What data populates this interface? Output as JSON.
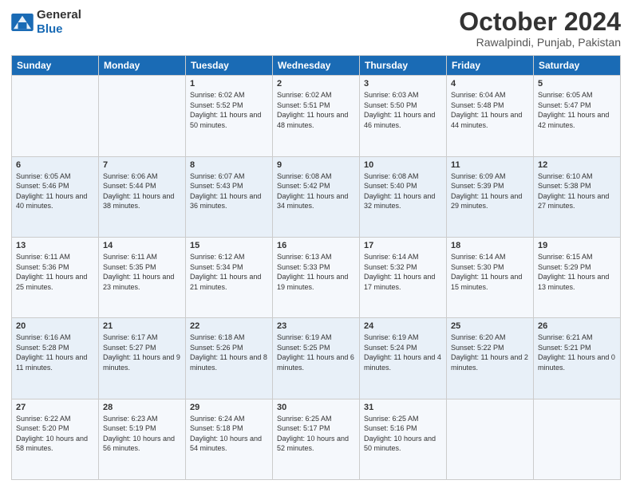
{
  "logo": {
    "general": "General",
    "blue": "Blue"
  },
  "header": {
    "month": "October 2024",
    "location": "Rawalpindi, Punjab, Pakistan"
  },
  "days": [
    "Sunday",
    "Monday",
    "Tuesday",
    "Wednesday",
    "Thursday",
    "Friday",
    "Saturday"
  ],
  "weeks": [
    [
      {
        "day": "",
        "content": ""
      },
      {
        "day": "",
        "content": ""
      },
      {
        "day": "1",
        "content": "Sunrise: 6:02 AM\nSunset: 5:52 PM\nDaylight: 11 hours and 50 minutes."
      },
      {
        "day": "2",
        "content": "Sunrise: 6:02 AM\nSunset: 5:51 PM\nDaylight: 11 hours and 48 minutes."
      },
      {
        "day": "3",
        "content": "Sunrise: 6:03 AM\nSunset: 5:50 PM\nDaylight: 11 hours and 46 minutes."
      },
      {
        "day": "4",
        "content": "Sunrise: 6:04 AM\nSunset: 5:48 PM\nDaylight: 11 hours and 44 minutes."
      },
      {
        "day": "5",
        "content": "Sunrise: 6:05 AM\nSunset: 5:47 PM\nDaylight: 11 hours and 42 minutes."
      }
    ],
    [
      {
        "day": "6",
        "content": "Sunrise: 6:05 AM\nSunset: 5:46 PM\nDaylight: 11 hours and 40 minutes."
      },
      {
        "day": "7",
        "content": "Sunrise: 6:06 AM\nSunset: 5:44 PM\nDaylight: 11 hours and 38 minutes."
      },
      {
        "day": "8",
        "content": "Sunrise: 6:07 AM\nSunset: 5:43 PM\nDaylight: 11 hours and 36 minutes."
      },
      {
        "day": "9",
        "content": "Sunrise: 6:08 AM\nSunset: 5:42 PM\nDaylight: 11 hours and 34 minutes."
      },
      {
        "day": "10",
        "content": "Sunrise: 6:08 AM\nSunset: 5:40 PM\nDaylight: 11 hours and 32 minutes."
      },
      {
        "day": "11",
        "content": "Sunrise: 6:09 AM\nSunset: 5:39 PM\nDaylight: 11 hours and 29 minutes."
      },
      {
        "day": "12",
        "content": "Sunrise: 6:10 AM\nSunset: 5:38 PM\nDaylight: 11 hours and 27 minutes."
      }
    ],
    [
      {
        "day": "13",
        "content": "Sunrise: 6:11 AM\nSunset: 5:36 PM\nDaylight: 11 hours and 25 minutes."
      },
      {
        "day": "14",
        "content": "Sunrise: 6:11 AM\nSunset: 5:35 PM\nDaylight: 11 hours and 23 minutes."
      },
      {
        "day": "15",
        "content": "Sunrise: 6:12 AM\nSunset: 5:34 PM\nDaylight: 11 hours and 21 minutes."
      },
      {
        "day": "16",
        "content": "Sunrise: 6:13 AM\nSunset: 5:33 PM\nDaylight: 11 hours and 19 minutes."
      },
      {
        "day": "17",
        "content": "Sunrise: 6:14 AM\nSunset: 5:32 PM\nDaylight: 11 hours and 17 minutes."
      },
      {
        "day": "18",
        "content": "Sunrise: 6:14 AM\nSunset: 5:30 PM\nDaylight: 11 hours and 15 minutes."
      },
      {
        "day": "19",
        "content": "Sunrise: 6:15 AM\nSunset: 5:29 PM\nDaylight: 11 hours and 13 minutes."
      }
    ],
    [
      {
        "day": "20",
        "content": "Sunrise: 6:16 AM\nSunset: 5:28 PM\nDaylight: 11 hours and 11 minutes."
      },
      {
        "day": "21",
        "content": "Sunrise: 6:17 AM\nSunset: 5:27 PM\nDaylight: 11 hours and 9 minutes."
      },
      {
        "day": "22",
        "content": "Sunrise: 6:18 AM\nSunset: 5:26 PM\nDaylight: 11 hours and 8 minutes."
      },
      {
        "day": "23",
        "content": "Sunrise: 6:19 AM\nSunset: 5:25 PM\nDaylight: 11 hours and 6 minutes."
      },
      {
        "day": "24",
        "content": "Sunrise: 6:19 AM\nSunset: 5:24 PM\nDaylight: 11 hours and 4 minutes."
      },
      {
        "day": "25",
        "content": "Sunrise: 6:20 AM\nSunset: 5:22 PM\nDaylight: 11 hours and 2 minutes."
      },
      {
        "day": "26",
        "content": "Sunrise: 6:21 AM\nSunset: 5:21 PM\nDaylight: 11 hours and 0 minutes."
      }
    ],
    [
      {
        "day": "27",
        "content": "Sunrise: 6:22 AM\nSunset: 5:20 PM\nDaylight: 10 hours and 58 minutes."
      },
      {
        "day": "28",
        "content": "Sunrise: 6:23 AM\nSunset: 5:19 PM\nDaylight: 10 hours and 56 minutes."
      },
      {
        "day": "29",
        "content": "Sunrise: 6:24 AM\nSunset: 5:18 PM\nDaylight: 10 hours and 54 minutes."
      },
      {
        "day": "30",
        "content": "Sunrise: 6:25 AM\nSunset: 5:17 PM\nDaylight: 10 hours and 52 minutes."
      },
      {
        "day": "31",
        "content": "Sunrise: 6:25 AM\nSunset: 5:16 PM\nDaylight: 10 hours and 50 minutes."
      },
      {
        "day": "",
        "content": ""
      },
      {
        "day": "",
        "content": ""
      }
    ]
  ]
}
